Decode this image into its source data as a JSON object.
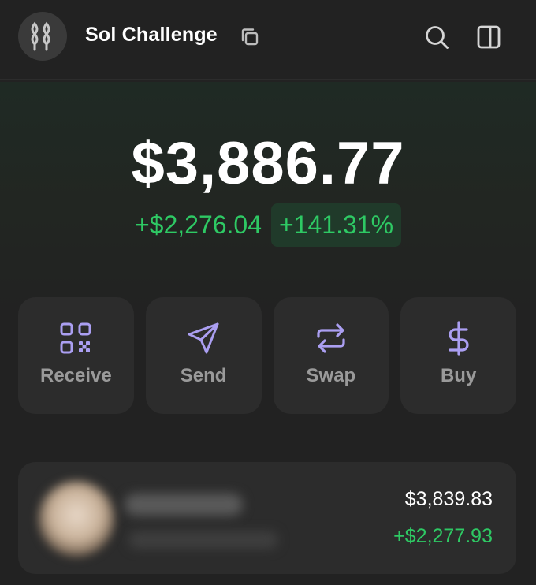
{
  "header": {
    "account_name": "Sol Challenge",
    "avatar_icon": "chain-links-icon",
    "copy_icon": "copy-icon",
    "search_icon": "search-icon",
    "panel_icon": "side-panel-icon"
  },
  "balance": {
    "total": "$3,886.77",
    "change_amount": "+$2,276.04",
    "change_percent": "+141.31%"
  },
  "actions": [
    {
      "label": "Receive",
      "icon": "qr-code-icon"
    },
    {
      "label": "Send",
      "icon": "send-arrow-icon"
    },
    {
      "label": "Swap",
      "icon": "swap-arrows-icon"
    },
    {
      "label": "Buy",
      "icon": "dollar-icon"
    }
  ],
  "token": {
    "value": "$3,839.83",
    "change": "+$2,277.93"
  },
  "colors": {
    "accent": "#ab9ff2",
    "positive": "#2ec964",
    "background": "#222222",
    "card": "#2c2c2c"
  }
}
